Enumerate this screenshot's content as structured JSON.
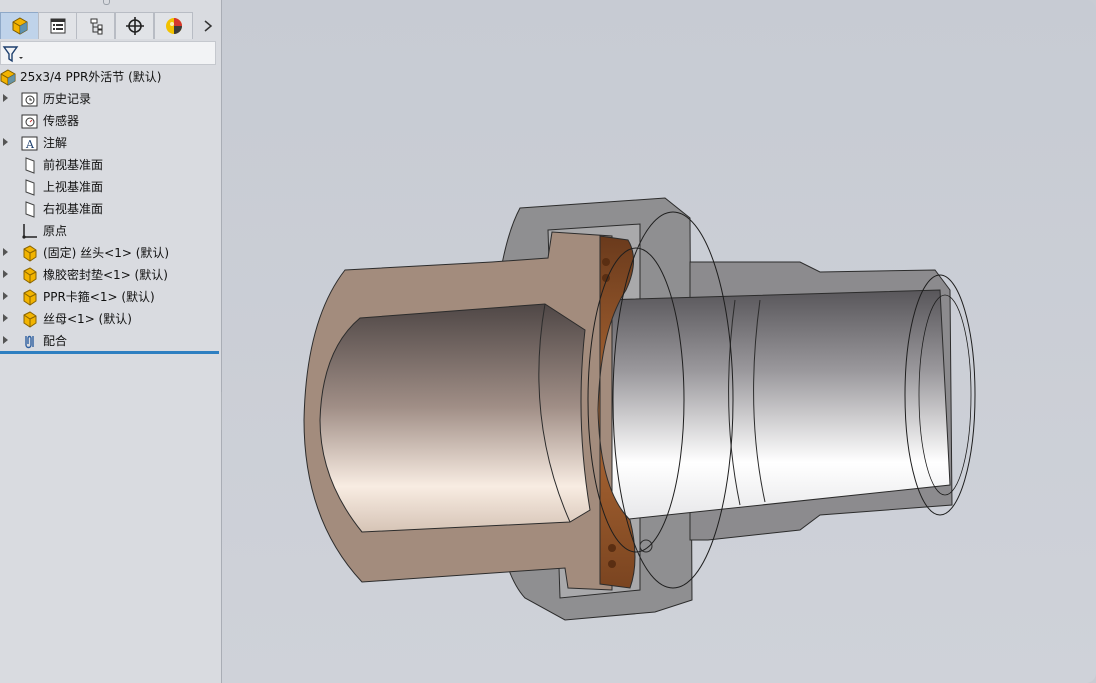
{
  "tabs": [
    {
      "name": "featuremanager",
      "icon": "part-cube-icon",
      "active": true
    },
    {
      "name": "propertymanager",
      "icon": "property-list-icon",
      "active": false
    },
    {
      "name": "configurationmanager",
      "icon": "configuration-icon",
      "active": false
    },
    {
      "name": "dimxpertmanager",
      "icon": "crosshair-target-icon",
      "active": false
    },
    {
      "name": "displaymanager",
      "icon": "appearance-pie-icon",
      "active": false
    }
  ],
  "tree": {
    "root": {
      "label": "25x3/4 PPR外活节 (默认)",
      "icon": "assembly-icon"
    },
    "items": [
      {
        "label": "历史记录",
        "icon": "history-folder-icon",
        "expandable": true
      },
      {
        "label": "传感器",
        "icon": "sensor-folder-icon",
        "expandable": false
      },
      {
        "label": "注解",
        "icon": "annotation-folder-icon",
        "expandable": true
      },
      {
        "label": "前视基准面",
        "icon": "plane-icon",
        "expandable": false
      },
      {
        "label": "上视基准面",
        "icon": "plane-icon",
        "expandable": false
      },
      {
        "label": "右视基准面",
        "icon": "plane-icon",
        "expandable": false
      },
      {
        "label": "原点",
        "icon": "origin-icon",
        "expandable": false
      },
      {
        "label": "(固定) 丝头<1> (默认)",
        "icon": "part-icon",
        "expandable": true
      },
      {
        "label": "橡胶密封垫<1> (默认)",
        "icon": "part-icon",
        "expandable": true
      },
      {
        "label": "PPR卡箍<1> (默认)",
        "icon": "part-icon",
        "expandable": true
      },
      {
        "label": "丝母<1> (默认)",
        "icon": "part-icon",
        "expandable": true
      },
      {
        "label": "配合",
        "icon": "mates-icon",
        "expandable": true
      }
    ]
  },
  "colors": {
    "sidebar_bg": "#d9dbe0",
    "viewport_bg": "#c9ccd3",
    "rollback_bar": "#2e7fc1",
    "part_icon": "#f2b400",
    "ppr_tan": "#a58b79",
    "metal_gray": "#8e8e90"
  }
}
